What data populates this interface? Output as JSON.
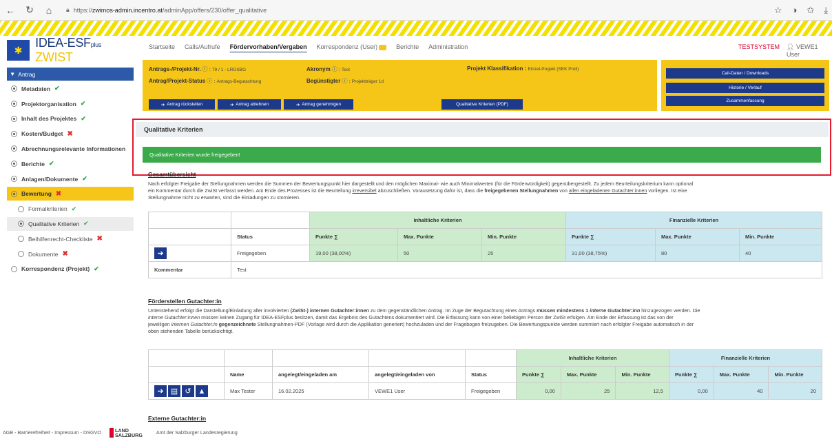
{
  "browser": {
    "url_prefix": "https://",
    "url_host": "zwimos-admin.incentro.at",
    "url_path": "/adminApp/offers/230/offer_qualitative"
  },
  "logo": {
    "main": "IDEA-ESF",
    "plus": "plus",
    "zwist": "ZWIST"
  },
  "topnav": {
    "items": [
      "Startseite",
      "Calls/Aufrufe",
      "Fördervorhaben/Vergaben",
      "Korrespondenz (User)",
      "Berichte",
      "Administration"
    ],
    "testsystem": "TESTSYSTEM",
    "user": "VEWE1 User"
  },
  "sidebar": {
    "antrag": "Antrag",
    "items": [
      {
        "label": "Metadaten",
        "status": "ok"
      },
      {
        "label": "Projektorganisation",
        "status": "ok"
      },
      {
        "label": "Inhalt des Projektes",
        "status": "ok"
      },
      {
        "label": "Kosten/Budget",
        "status": "bad"
      },
      {
        "label": "Abrechnungsrelevante Informationen",
        "status": ""
      },
      {
        "label": "Berichte",
        "status": "ok"
      },
      {
        "label": "Anlagen/Dokumente",
        "status": "ok"
      },
      {
        "label": "Bewertung",
        "status": "bad"
      }
    ],
    "subitems": [
      {
        "label": "Formalkriterien",
        "status": "ok"
      },
      {
        "label": "Qualitative Kriterien",
        "status": "ok"
      },
      {
        "label": "Beihilfenrecht-Checkliste",
        "status": "bad"
      },
      {
        "label": "Dokumente",
        "status": "bad"
      }
    ],
    "korrespondenz": "Korrespondenz (Projekt)"
  },
  "header": {
    "antrag_label": "Antrags-/Projekt-Nr.",
    "antrag_value": "79 / 1 - LRGSBG",
    "akronym_label": "Akronym",
    "akronym_value": "Test",
    "klass_label": "Projekt Klassifikation :",
    "klass_value": "Einzel-Projekt (SEK Proli)",
    "status_label": "Antrag/Projekt-Status",
    "status_value": "Antrags-Begutachtung",
    "beg_label": "Begünstigter",
    "beg_value": "Projektträger 1d",
    "btn_rueck": "Antrag rückstellen",
    "btn_ablehnen": "Antrag ablehnen",
    "btn_genehmigen": "Antrag genehmigen",
    "btn_pdf": "Qualitative Kriterien (PDF)",
    "btn_call": "Call-Daten / Downloads",
    "btn_historie": "Historie / Verlauf",
    "btn_zusammen": "Zusammenfassung"
  },
  "qk": {
    "title": "Qualitative Kriterien",
    "success": "Qualitative Kriterien wurde freigegeben!"
  },
  "gesamt": {
    "title": "Gesamtübersicht",
    "text1": "Nach erfolgter Freigabe der Stellungnahmen werden die Summen der Bewertungspunkt hier dargestellt und den möglichen Maximal- wie auch Minimalwerten (für die Förderwürdigkeit) gegenübergestellt. Zu jedem Beurteilungskriterium kann optional",
    "text2a": "ein Kommentar durch die ZwiSt verfasst werden. Am Ende des Prozesses ist die Beurteilung ",
    "text2b": "irreversibel",
    "text2c": " abzuschließen. Vorausetzung dafür ist, dass die ",
    "text2d": "freigegebenen Stellungnahmen",
    "text2e": " von ",
    "text2f": "allen eingeladenen Gutachter:innen",
    "text2g": " vorliegen. Ist eine",
    "text3": "Stellungnahme nicht zu erwarten, sind die Einladungen zu stornieren.",
    "table": {
      "group_inhalt": "Inhaltliche Kriterien",
      "group_finanz": "Finanzielle Kriterien",
      "h_status": "Status",
      "h_punkte": "Punkte ∑",
      "h_max": "Max. Punkte",
      "h_min": "Min. Punkte",
      "status": "Freigegeben",
      "i_punkte": "19,00 (38,00%)",
      "i_max": "50",
      "i_min": "25",
      "f_punkte": "31,00 (38,75%)",
      "f_max": "80",
      "f_min": "40",
      "kommentar_label": "Kommentar",
      "kommentar_value": "Test"
    }
  },
  "foerder": {
    "title": "Förderstellen Gutachter:in",
    "l1a": "Untenstehend erfolgt die Darstellung/Einladung aller involvierten ",
    "l1b": "(ZwiSt-) internen Gutachter:innen",
    "l1c": " zu dem gegenständlichen Antrag. Im Zuge der Begutachtung eines Antrags ",
    "l1d": "müssen mindestens 1 ",
    "l1e": "interne Gutachter:inn",
    "l1f": " hinzugezogen werden. Die",
    "l2a": "interne Gutachter:innen",
    "l2b": " müssen keinen Zugang für IDEA-ESFplus besitzen, damit das Ergebnis des Gutachtens dokumentiert wird. Die Erfassung kann von einer beliebigen Person der ZwiSt erfolgen. Am Ende der Erfassung ist das von der",
    "l3a": "jeweiligen ",
    "l3b": "internen Gutachter:in",
    "l3c": " gegenzeichnete",
    "l3d": " Stellungnahmen-PDF (Vorlage wird durch die Applikation generiert) hochzuladen und der Fragebogen freizugeben. Die Bewertungspunkte werden summiert nach erfolgter Freigabe automatisch in der",
    "l4": "oben stehenden Tabelle berücksichtigt.",
    "table": {
      "group_inhalt": "Inhaltliche Kriterien",
      "group_finanz": "Finanzielle Kriterien",
      "h_name": "Name",
      "h_am": "angelegt/eingeladen am",
      "h_von": "angelegt/eingeladen von",
      "h_status": "Status",
      "h_punkte": "Punkte ∑",
      "h_max": "Max. Punkte",
      "h_min": "Min. Punkte",
      "name": "Max Tester",
      "am": "16.02.2025",
      "von": "VEWE1 User",
      "status": "Freigegeben",
      "i_punkte": "0,00",
      "i_max": "25",
      "i_min": "12,5",
      "f_punkte": "0,00",
      "f_max": "40",
      "f_min": "20"
    }
  },
  "extern": {
    "title": "Externe Gutachter:in"
  },
  "footer": {
    "links": "AGB - Barrierefreiheit - Impressum - DSGVO",
    "land1": "LAND",
    "land2": "SALZBURG",
    "amt": "Amt der Salzburger Landesregierung"
  }
}
